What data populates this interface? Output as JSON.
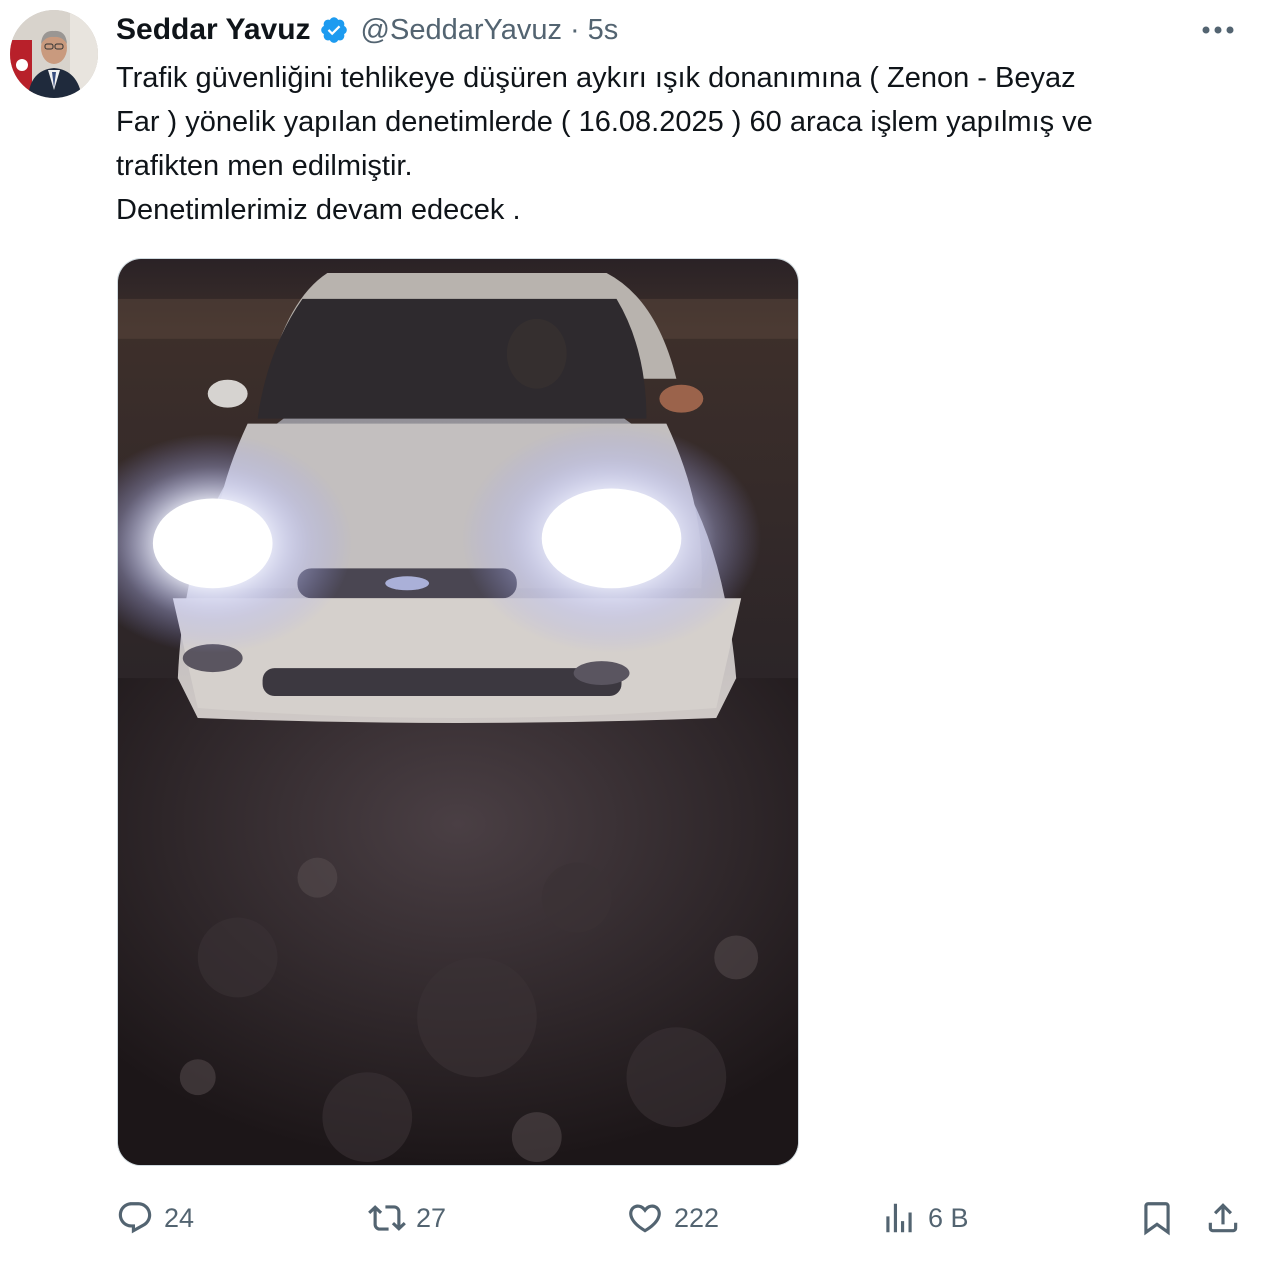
{
  "author": {
    "display_name": "Seddar Yavuz",
    "handle": "@SeddarYavuz",
    "time": "5s",
    "separator": "·",
    "verified": true,
    "verified_color": "#1d9bf0"
  },
  "tweet": {
    "lines": [
      "Trafik güvenliğini tehlikeye düşüren aykırı ışık donanımına  ( Zenon - Beyaz",
      "Far ) yönelik yapılan denetimlerde ( 16.08.2025 ) 60 araca işlem yapılmış ve",
      "trafikten men edilmiştir.",
      "Denetimlerimiz devam edecek ."
    ]
  },
  "media": {
    "description_icon": "photo-car-headlights"
  },
  "actions": {
    "reply": {
      "icon": "reply-icon",
      "count": "24"
    },
    "retweet": {
      "icon": "retweet-icon",
      "count": "27"
    },
    "like": {
      "icon": "heart-icon",
      "count": "222"
    },
    "views": {
      "icon": "views-icon",
      "count": "6 B"
    },
    "bookmark": {
      "icon": "bookmark-icon"
    },
    "share": {
      "icon": "share-icon"
    }
  },
  "colors": {
    "text": "#0f1419",
    "muted": "#536471",
    "accent": "#1d9bf0"
  }
}
